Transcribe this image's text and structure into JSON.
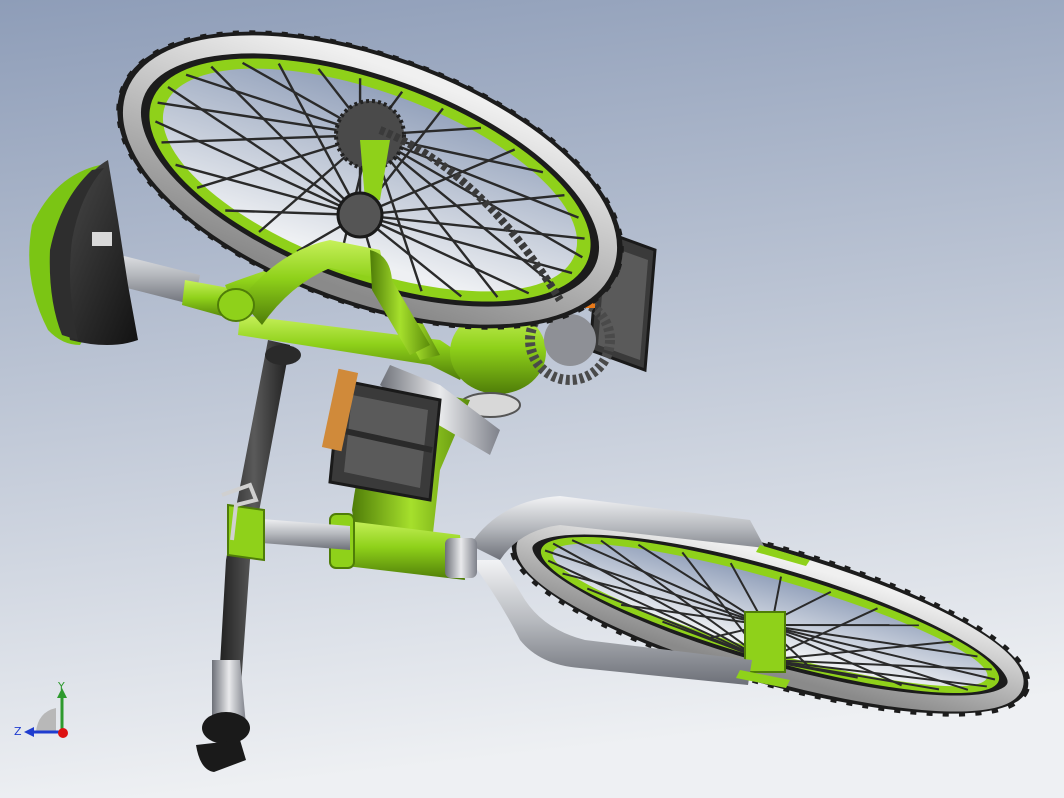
{
  "viewport": {
    "background_top": "#8e9db8",
    "background_bottom": "#eef0f3"
  },
  "colors": {
    "frame_green": "#8fd11a",
    "frame_green_dark": "#4f7d08",
    "frame_green_light": "#c6f05a",
    "tire_black": "#1c1c1c",
    "tire_gray": "#a8a8a8",
    "tire_gray_light": "#e4e4e4",
    "metal": "#b5b8bd",
    "metal_dark": "#6d7078",
    "spoke": "#2a2a2a",
    "seat": "#2b2b2b"
  },
  "triad": {
    "x_label": "",
    "y_label": "Y",
    "z_label": "Z",
    "icons": [
      "y-axis-arrow-icon",
      "z-axis-arrow-icon",
      "x-axis-dot-icon"
    ]
  },
  "model": {
    "parts": [
      "rear-wheel",
      "front-wheel",
      "frame",
      "seat",
      "seat-post",
      "handlebar",
      "fork",
      "crank",
      "pedal-left",
      "pedal-right",
      "chain",
      "chainring",
      "rear-sprocket"
    ]
  }
}
